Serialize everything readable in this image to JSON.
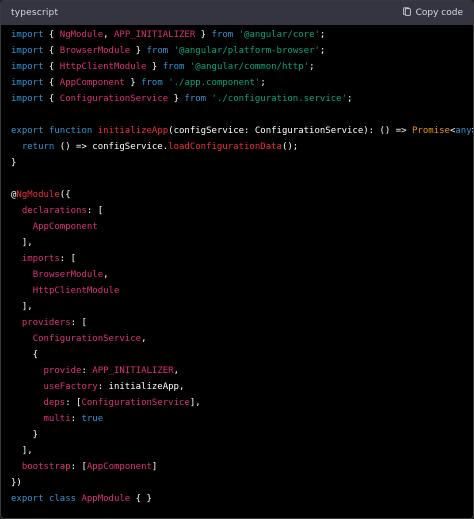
{
  "header": {
    "language": "typescript",
    "copy_label": "Copy code"
  },
  "colors": {
    "keyword": "#2e95d3",
    "string": "#00a67d",
    "identifier": "#df3079",
    "function": "#f22c3d",
    "plain": "#ffffff",
    "type": "#e9950c",
    "header_bg": "#343541",
    "code_bg": "#000000"
  },
  "code": {
    "lines": [
      [
        {
          "t": "import",
          "c": "kw"
        },
        {
          "t": " { ",
          "c": "wh"
        },
        {
          "t": "NgModule",
          "c": "red"
        },
        {
          "t": ", ",
          "c": "wh"
        },
        {
          "t": "APP_INITIALIZER",
          "c": "red"
        },
        {
          "t": " } ",
          "c": "wh"
        },
        {
          "t": "from",
          "c": "kw"
        },
        {
          "t": " ",
          "c": "wh"
        },
        {
          "t": "'@angular/core'",
          "c": "str"
        },
        {
          "t": ";",
          "c": "wh"
        }
      ],
      [
        {
          "t": "import",
          "c": "kw"
        },
        {
          "t": " { ",
          "c": "wh"
        },
        {
          "t": "BrowserModule",
          "c": "red"
        },
        {
          "t": " } ",
          "c": "wh"
        },
        {
          "t": "from",
          "c": "kw"
        },
        {
          "t": " ",
          "c": "wh"
        },
        {
          "t": "'@angular/platform-browser'",
          "c": "str"
        },
        {
          "t": ";",
          "c": "wh"
        }
      ],
      [
        {
          "t": "import",
          "c": "kw"
        },
        {
          "t": " { ",
          "c": "wh"
        },
        {
          "t": "HttpClientModule",
          "c": "red"
        },
        {
          "t": " } ",
          "c": "wh"
        },
        {
          "t": "from",
          "c": "kw"
        },
        {
          "t": " ",
          "c": "wh"
        },
        {
          "t": "'@angular/common/http'",
          "c": "str"
        },
        {
          "t": ";",
          "c": "wh"
        }
      ],
      [
        {
          "t": "import",
          "c": "kw"
        },
        {
          "t": " { ",
          "c": "wh"
        },
        {
          "t": "AppComponent",
          "c": "red"
        },
        {
          "t": " } ",
          "c": "wh"
        },
        {
          "t": "from",
          "c": "kw"
        },
        {
          "t": " ",
          "c": "wh"
        },
        {
          "t": "'./app.component'",
          "c": "str"
        },
        {
          "t": ";",
          "c": "wh"
        }
      ],
      [
        {
          "t": "import",
          "c": "kw"
        },
        {
          "t": " { ",
          "c": "wh"
        },
        {
          "t": "ConfigurationService",
          "c": "red"
        },
        {
          "t": " } ",
          "c": "wh"
        },
        {
          "t": "from",
          "c": "kw"
        },
        {
          "t": " ",
          "c": "wh"
        },
        {
          "t": "'./configuration.service'",
          "c": "str"
        },
        {
          "t": ";",
          "c": "wh"
        }
      ],
      [],
      [
        {
          "t": "export",
          "c": "kw"
        },
        {
          "t": " ",
          "c": "wh"
        },
        {
          "t": "function",
          "c": "kw"
        },
        {
          "t": " ",
          "c": "wh"
        },
        {
          "t": "initializeApp",
          "c": "fn"
        },
        {
          "t": "(configService: ConfigurationService): () => ",
          "c": "wh"
        },
        {
          "t": "Promise",
          "c": "am"
        },
        {
          "t": "<",
          "c": "wh"
        },
        {
          "t": "any",
          "c": "kw"
        },
        {
          "t": "> {",
          "c": "wh"
        }
      ],
      [
        {
          "t": "  ",
          "c": "wh"
        },
        {
          "t": "return",
          "c": "kw"
        },
        {
          "t": " () => configService.",
          "c": "wh"
        },
        {
          "t": "loadConfigurationData",
          "c": "fn"
        },
        {
          "t": "();",
          "c": "wh"
        }
      ],
      [
        {
          "t": "}",
          "c": "wh"
        }
      ],
      [],
      [
        {
          "t": "@",
          "c": "wh"
        },
        {
          "t": "NgModule",
          "c": "fn"
        },
        {
          "t": "({",
          "c": "wh"
        }
      ],
      [
        {
          "t": "  ",
          "c": "wh"
        },
        {
          "t": "declarations",
          "c": "red"
        },
        {
          "t": ": [",
          "c": "wh"
        }
      ],
      [
        {
          "t": "    ",
          "c": "wh"
        },
        {
          "t": "AppComponent",
          "c": "red"
        }
      ],
      [
        {
          "t": "  ],",
          "c": "wh"
        }
      ],
      [
        {
          "t": "  ",
          "c": "wh"
        },
        {
          "t": "imports",
          "c": "red"
        },
        {
          "t": ": [",
          "c": "wh"
        }
      ],
      [
        {
          "t": "    ",
          "c": "wh"
        },
        {
          "t": "BrowserModule",
          "c": "red"
        },
        {
          "t": ",",
          "c": "wh"
        }
      ],
      [
        {
          "t": "    ",
          "c": "wh"
        },
        {
          "t": "HttpClientModule",
          "c": "red"
        }
      ],
      [
        {
          "t": "  ],",
          "c": "wh"
        }
      ],
      [
        {
          "t": "  ",
          "c": "wh"
        },
        {
          "t": "providers",
          "c": "red"
        },
        {
          "t": ": [",
          "c": "wh"
        }
      ],
      [
        {
          "t": "    ",
          "c": "wh"
        },
        {
          "t": "ConfigurationService",
          "c": "red"
        },
        {
          "t": ",",
          "c": "wh"
        }
      ],
      [
        {
          "t": "    {",
          "c": "wh"
        }
      ],
      [
        {
          "t": "      ",
          "c": "wh"
        },
        {
          "t": "provide",
          "c": "red"
        },
        {
          "t": ": ",
          "c": "wh"
        },
        {
          "t": "APP_INITIALIZER",
          "c": "red"
        },
        {
          "t": ",",
          "c": "wh"
        }
      ],
      [
        {
          "t": "      ",
          "c": "wh"
        },
        {
          "t": "useFactory",
          "c": "red"
        },
        {
          "t": ": initializeApp,",
          "c": "wh"
        }
      ],
      [
        {
          "t": "      ",
          "c": "wh"
        },
        {
          "t": "deps",
          "c": "red"
        },
        {
          "t": ": [",
          "c": "wh"
        },
        {
          "t": "ConfigurationService",
          "c": "red"
        },
        {
          "t": "],",
          "c": "wh"
        }
      ],
      [
        {
          "t": "      ",
          "c": "wh"
        },
        {
          "t": "multi",
          "c": "red"
        },
        {
          "t": ": ",
          "c": "wh"
        },
        {
          "t": "true",
          "c": "kw"
        }
      ],
      [
        {
          "t": "    }",
          "c": "wh"
        }
      ],
      [
        {
          "t": "  ],",
          "c": "wh"
        }
      ],
      [
        {
          "t": "  ",
          "c": "wh"
        },
        {
          "t": "bootstrap",
          "c": "red"
        },
        {
          "t": ": [",
          "c": "wh"
        },
        {
          "t": "AppComponent",
          "c": "red"
        },
        {
          "t": "]",
          "c": "wh"
        }
      ],
      [
        {
          "t": "})",
          "c": "wh"
        }
      ],
      [
        {
          "t": "export",
          "c": "kw"
        },
        {
          "t": " ",
          "c": "wh"
        },
        {
          "t": "class",
          "c": "kw"
        },
        {
          "t": " ",
          "c": "wh"
        },
        {
          "t": "AppModule",
          "c": "red"
        },
        {
          "t": " { }",
          "c": "wh"
        }
      ]
    ]
  }
}
